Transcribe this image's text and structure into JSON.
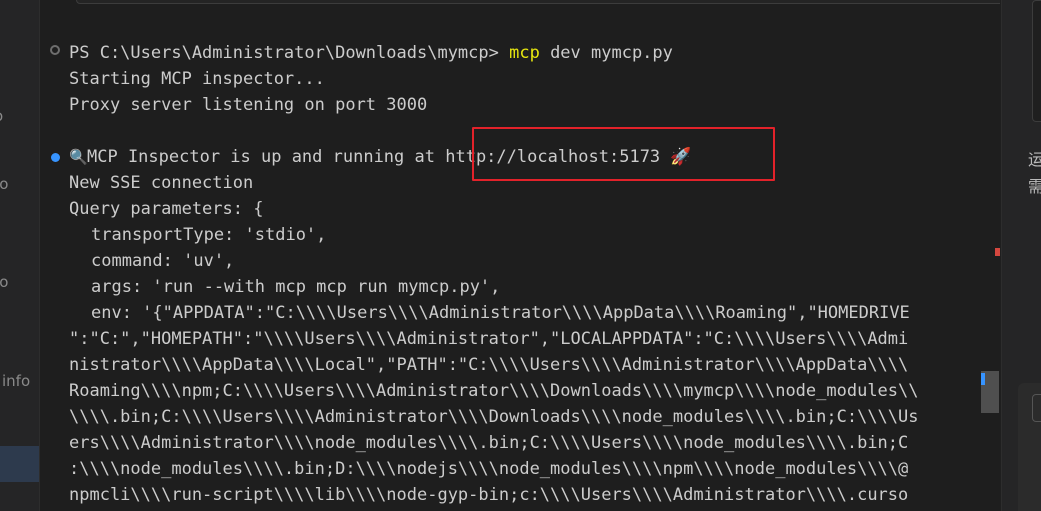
{
  "left_panel": {
    "labels": [
      "o",
      "fo",
      "fo",
      "info"
    ]
  },
  "right_panel": {
    "text_lines": [
      "运",
      "需"
    ]
  },
  "terminal": {
    "prompt": "PS C:\\Users\\Administrator\\Downloads\\mymcp> ",
    "command_keyword": "mcp",
    "command_rest": " dev mymcp.py",
    "line_starting": "Starting MCP inspector...",
    "line_proxy": "Proxy server listening on port 3000",
    "inspector_icon": "magnifier-emoji",
    "inspector_text_before": "MCP Inspector is up and running at ",
    "inspector_url": "http://localhost:5173",
    "rocket_icon": "rocket-emoji",
    "line_sse": "New SSE connection",
    "line_query": "Query parameters: {",
    "param_transport": "transportType: 'stdio',",
    "param_command": "command: 'uv',",
    "param_args": "args: 'run --with mcp mcp run mymcp.py',",
    "param_env_lines": [
      "env: '{\"APPDATA\":\"C:\\\\\\\\Users\\\\\\\\Administrator\\\\\\\\AppData\\\\\\\\Roaming\",\"HOMEDRIVE",
      "\":\"C:\",\"HOMEPATH\":\"\\\\\\\\Users\\\\\\\\Administrator\",\"LOCALAPPDATA\":\"C:\\\\\\\\Users\\\\\\\\Admi",
      "nistrator\\\\\\\\AppData\\\\\\\\Local\",\"PATH\":\"C:\\\\\\\\Users\\\\\\\\Administrator\\\\\\\\AppData\\\\\\\\",
      "Roaming\\\\\\\\npm;C:\\\\\\\\Users\\\\\\\\Administrator\\\\\\\\Downloads\\\\\\\\mymcp\\\\\\\\node_modules\\\\",
      "\\\\\\\\.bin;C:\\\\\\\\Users\\\\\\\\Administrator\\\\\\\\Downloads\\\\\\\\node_modules\\\\\\\\.bin;C:\\\\\\\\Us",
      "ers\\\\\\\\Administrator\\\\\\\\node_modules\\\\\\\\.bin;C:\\\\\\\\Users\\\\\\\\node_modules\\\\\\\\.bin;C",
      ":\\\\\\\\node_modules\\\\\\\\.bin;D:\\\\\\\\nodejs\\\\\\\\node_modules\\\\\\\\npm\\\\\\\\node_modules\\\\\\\\@",
      "npmcli\\\\\\\\run-script\\\\\\\\lib\\\\\\\\node-gyp-bin;c:\\\\\\\\Users\\\\\\\\Administrator\\\\\\\\.curso"
    ]
  },
  "colors": {
    "background": "#1e1e1e",
    "text": "#cccccc",
    "command_highlight": "#e5e510",
    "annotation_box": "#e3222a",
    "decoration_dot": "#3794ff"
  }
}
